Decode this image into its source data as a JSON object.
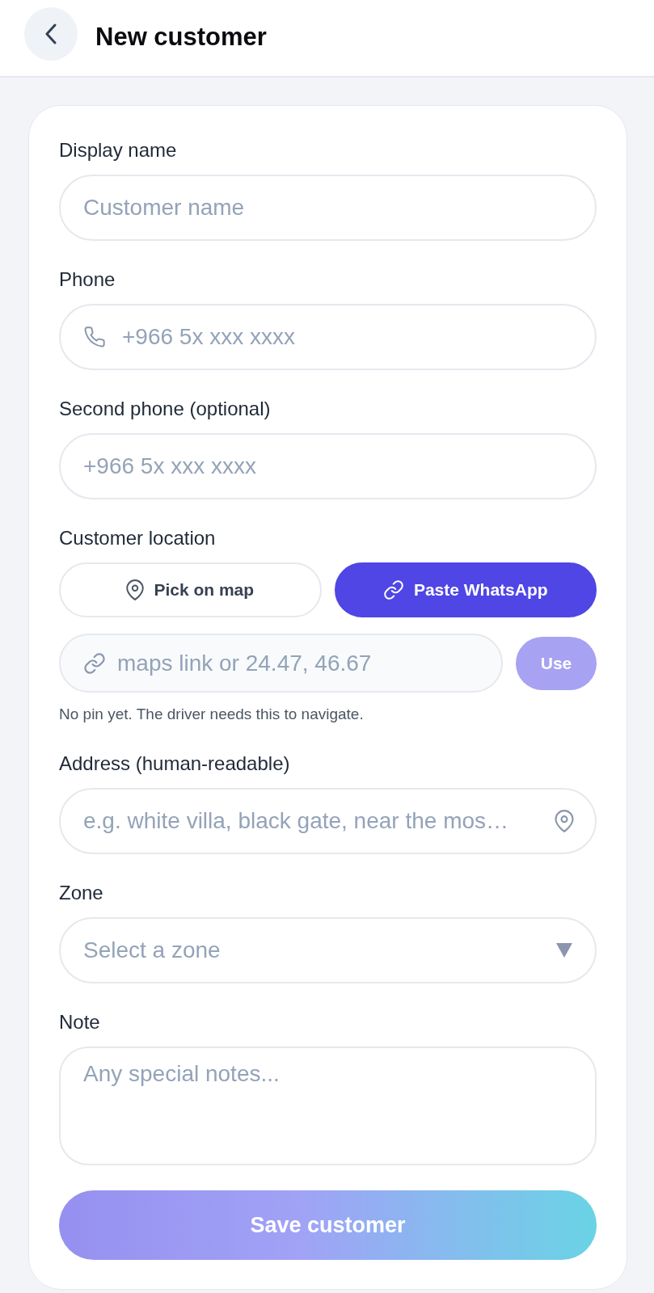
{
  "header": {
    "title": "New customer"
  },
  "fields": [
    {
      "kind": "text",
      "label": "Display name",
      "placeholder": "Customer name"
    },
    {
      "kind": "phone",
      "label": "Phone",
      "placeholder": "+966 5x xxx xxxx"
    },
    {
      "kind": "text",
      "label": "Second phone (optional)",
      "placeholder": "+966 5x xxx xxxx"
    },
    {
      "kind": "location",
      "label": "Customer location",
      "modes": [
        {
          "kind": "map",
          "label": "Pick on map",
          "selected": false
        },
        {
          "kind": "link",
          "label": "Paste WhatsApp",
          "selected": true
        }
      ],
      "link_field": {
        "placeholder": "maps link or 24.47, 46.67"
      },
      "use_button": {
        "label": "Use",
        "disabled": true
      },
      "hint": "No pin yet. The driver needs this to navigate."
    },
    {
      "kind": "address",
      "label": "Address (human-readable)",
      "placeholder": "e.g. white villa, black gate, near the mos…"
    },
    {
      "kind": "select",
      "label": "Zone",
      "placeholder": "Select a zone"
    },
    {
      "kind": "textarea",
      "label": "Note",
      "placeholder": "Any special notes..."
    }
  ],
  "save_button": {
    "label": "Save customer",
    "disabled": true
  }
}
